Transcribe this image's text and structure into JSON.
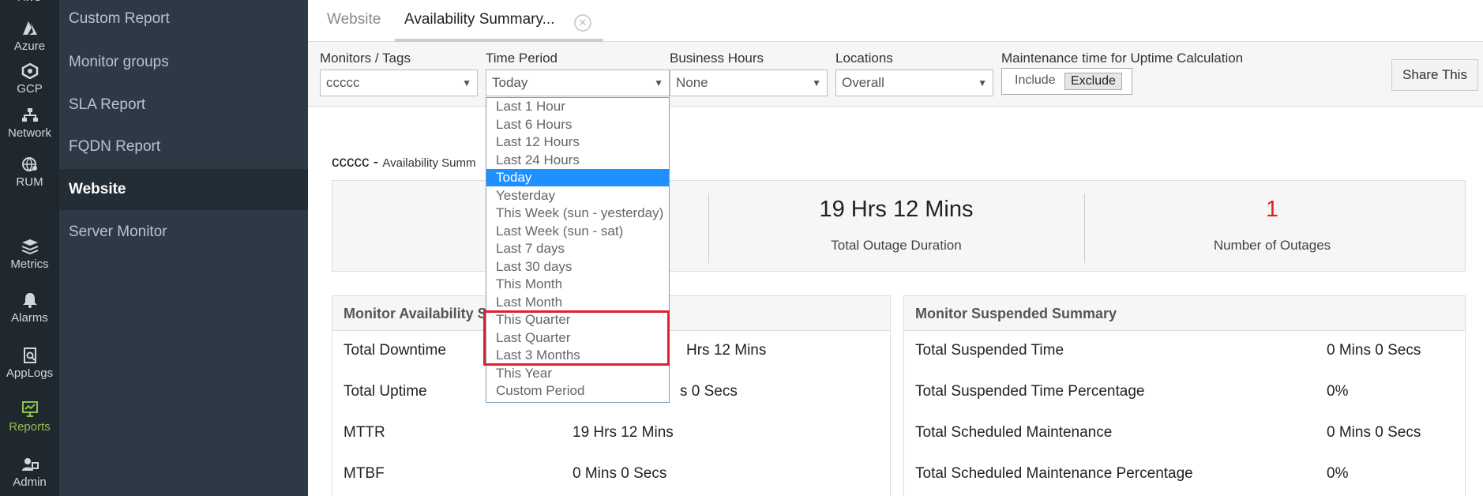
{
  "rail": {
    "items": [
      {
        "label": "Azure",
        "icon": "azure-icon"
      },
      {
        "label": "GCP",
        "icon": "gcp-icon"
      },
      {
        "label": "Network",
        "icon": "network-icon"
      },
      {
        "label": "RUM",
        "icon": "rum-icon"
      },
      {
        "label": "Metrics",
        "icon": "metrics-icon"
      },
      {
        "label": "Alarms",
        "icon": "bell-icon"
      },
      {
        "label": "AppLogs",
        "icon": "applogs-icon"
      },
      {
        "label": "Reports",
        "icon": "reports-icon",
        "active": true
      },
      {
        "label": "Admin",
        "icon": "admin-icon"
      }
    ],
    "active_color": "#8fc24a"
  },
  "nav": {
    "items": [
      {
        "label": "Custom Report"
      },
      {
        "label": "Monitor groups"
      },
      {
        "label": "SLA Report"
      },
      {
        "label": "FQDN Report"
      },
      {
        "label": "Website",
        "active": true
      },
      {
        "label": "Server Monitor"
      }
    ]
  },
  "tabs": {
    "items": [
      {
        "label": "Website"
      },
      {
        "label": "Availability Summary...",
        "active": true
      }
    ],
    "close_glyph": "✕"
  },
  "filters": {
    "monitors_label": "Monitors / Tags",
    "monitors_value": "ccccc",
    "time_label": "Time Period",
    "time_value": "Today",
    "business_label": "Business Hours",
    "business_value": "None",
    "locations_label": "Locations",
    "locations_value": "Overall",
    "maint_label": "Maintenance time for Uptime Calculation",
    "include_label": "Include",
    "exclude_label": "Exclude",
    "share_label": "Share This"
  },
  "report": {
    "title_main": "ccccc -",
    "title_sub": "Availability Summ"
  },
  "stats": {
    "outage_duration_value": "19 Hrs 12 Mins",
    "outage_duration_label": "Total Outage Duration",
    "outages_value": "1",
    "outages_label": "Number of Outages",
    "accent_red": "#e02020"
  },
  "availability_panel": {
    "title": "Monitor Availability S",
    "rows": [
      {
        "label": "Total Downtime",
        "value": "Hrs 12 Mins"
      },
      {
        "label": "Total Uptime",
        "value": "s 0 Secs"
      },
      {
        "label": "MTTR",
        "value": "19 Hrs 12 Mins"
      },
      {
        "label": "MTBF",
        "value": "0 Mins 0 Secs"
      }
    ]
  },
  "suspended_panel": {
    "title": "Monitor Suspended Summary",
    "rows": [
      {
        "label": "Total Suspended Time",
        "value": "0 Mins 0 Secs"
      },
      {
        "label": "Total Suspended Time Percentage",
        "value": "0%"
      },
      {
        "label": "Total Scheduled Maintenance",
        "value": "0 Mins 0 Secs"
      },
      {
        "label": "Total Scheduled Maintenance Percentage",
        "value": "0%"
      }
    ]
  },
  "dropdown": {
    "options": [
      "Last 1 Hour",
      "Last 6 Hours",
      "Last 12 Hours",
      "Last 24 Hours",
      "Today",
      "Yesterday",
      "This Week (sun - yesterday)",
      "Last Week (sun - sat)",
      "Last 7 days",
      "Last 30 days",
      "This Month",
      "Last Month",
      "This Quarter",
      "Last Quarter",
      "Last 3 Months",
      "This Year",
      "Custom Period"
    ],
    "selected": "Today",
    "selected_color": "#1e90ff",
    "highlight_color": "#e0202f"
  }
}
